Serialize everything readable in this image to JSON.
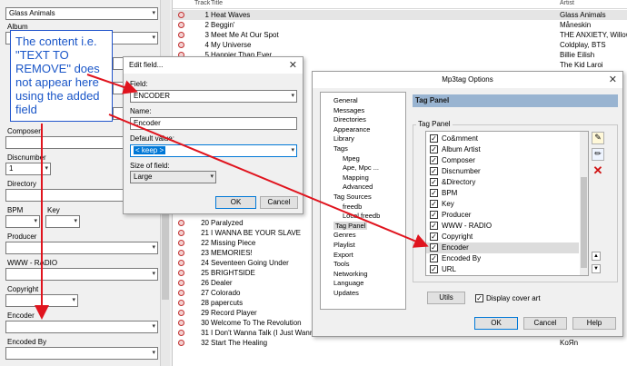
{
  "left_panel": {
    "album_artist_value": "Glass Animals",
    "labels": {
      "album": "Album",
      "composer": "Composer",
      "discnumber": "Discnumber",
      "directory": "Directory",
      "bpm": "BPM",
      "key": "Key",
      "producer": "Producer",
      "www_radio": "WWW - RADIO",
      "copyright": "Copyright",
      "encoder": "Encoder",
      "encoded_by": "Encoded By"
    },
    "discnumber_value": "1"
  },
  "grid": {
    "col_track": "Track",
    "col_title": "Title",
    "col_artist": "Artist",
    "rows": [
      {
        "num": "1",
        "title": "Heat Waves",
        "artist": "Glass Animals"
      },
      {
        "num": "2",
        "title": "Beggin'",
        "artist": "Måneskin"
      },
      {
        "num": "3",
        "title": "Meet Me At Our Spot",
        "artist": "THE ANXIETY, Willow,"
      },
      {
        "num": "4",
        "title": "My Universe",
        "artist": "Coldplay, BTS"
      },
      {
        "num": "5",
        "title": "Happier Than Ever",
        "artist": "Billie Eilish"
      },
      {
        "num": "",
        "title": "",
        "artist": "The Kid Laroi"
      },
      {
        "num": "20",
        "title": "Paralyzed",
        "artist": ""
      },
      {
        "num": "21",
        "title": "I WANNA BE YOUR SLAVE",
        "artist": ""
      },
      {
        "num": "22",
        "title": "Missing Piece",
        "artist": ""
      },
      {
        "num": "23",
        "title": "MEMORIES!",
        "artist": ""
      },
      {
        "num": "24",
        "title": "Seventeen Going Under",
        "artist": ""
      },
      {
        "num": "25",
        "title": "BRIGHTSIDE",
        "artist": ""
      },
      {
        "num": "26",
        "title": "Dealer",
        "artist": ""
      },
      {
        "num": "27",
        "title": "Colorado",
        "artist": ""
      },
      {
        "num": "28",
        "title": "papercuts",
        "artist": ""
      },
      {
        "num": "29",
        "title": "Record Player",
        "artist": ""
      },
      {
        "num": "30",
        "title": "Welcome To The Revolution",
        "artist": ""
      },
      {
        "num": "31",
        "title": "I Don't Wanna Talk (I Just Wanna Dance)",
        "artist": "Glass Animals"
      },
      {
        "num": "32",
        "title": "Start The Healing",
        "artist": "KoЯn"
      }
    ]
  },
  "callout": {
    "text": "The content i.e. \"TEXT TO REMOVE\" does not appear here using the added field"
  },
  "edit_field": {
    "title": "Edit field...",
    "field_label": "Field:",
    "field_value": "ENCODER",
    "name_label": "Name:",
    "name_value": "Encoder",
    "default_label": "Default value:",
    "default_value": "< keep >",
    "size_label": "Size of field:",
    "size_value": "Large",
    "ok": "OK",
    "cancel": "Cancel"
  },
  "options": {
    "title": "Mp3tag Options",
    "tree": [
      {
        "label": "General",
        "level": 0
      },
      {
        "label": "Messages",
        "level": 0
      },
      {
        "label": "Directories",
        "level": 0
      },
      {
        "label": "Appearance",
        "level": 0
      },
      {
        "label": "Library",
        "level": 0
      },
      {
        "label": "Tags",
        "level": 0
      },
      {
        "label": "Mpeg",
        "level": 1
      },
      {
        "label": "Ape, Mpc ...",
        "level": 1
      },
      {
        "label": "Mapping",
        "level": 1
      },
      {
        "label": "Advanced",
        "level": 1
      },
      {
        "label": "Tag Sources",
        "level": 0
      },
      {
        "label": "freedb",
        "level": 1
      },
      {
        "label": "Local freedb",
        "level": 1
      },
      {
        "label": "Tag Panel",
        "level": 0
      },
      {
        "label": "Genres",
        "level": 0
      },
      {
        "label": "Playlist",
        "level": 0
      },
      {
        "label": "Export",
        "level": 0
      },
      {
        "label": "Tools",
        "level": 0
      },
      {
        "label": "Networking",
        "level": 0
      },
      {
        "label": "Language",
        "level": 0
      },
      {
        "label": "Updates",
        "level": 0
      }
    ],
    "section_header": "Tag Panel",
    "group_label": "Tag Panel",
    "items": [
      "Co&mment",
      "Album Artist",
      "Composer",
      "Discnumber",
      "&Directory",
      "BPM",
      "Key",
      "Producer",
      "WWW - RADIO",
      "Copyright",
      "Encoder",
      "Encoded By",
      "URL"
    ],
    "utils": "Utils",
    "display_cover": "Display cover art",
    "ok": "OK",
    "cancel": "Cancel",
    "help": "Help"
  },
  "colors": {
    "arrow": "#e0141e",
    "callout_text": "#1a56c8",
    "header_bar": "#99b4d1",
    "selection": "#0078d7"
  }
}
